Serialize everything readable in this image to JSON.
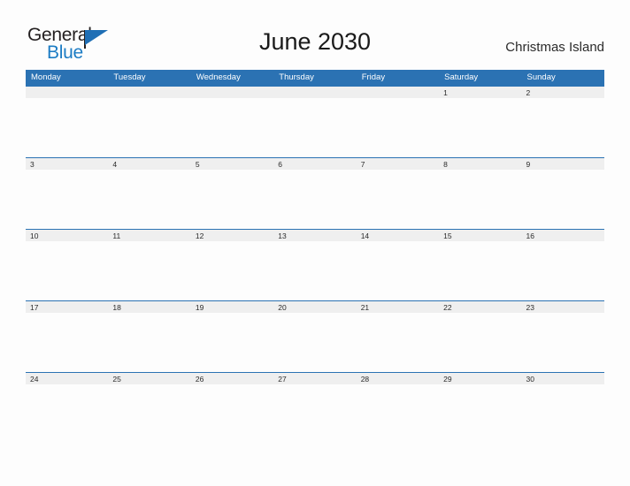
{
  "brand": {
    "name_part1": "General",
    "name_part2": "Blue",
    "flag_icon": "blue-flag-triangle",
    "color_dark": "#231f20",
    "color_blue": "#1c7cc4"
  },
  "header": {
    "month_title": "June 2030",
    "location": "Christmas Island"
  },
  "calendar": {
    "accent_color": "#2b72b3",
    "band_color": "#efefef",
    "weekdays": [
      "Monday",
      "Tuesday",
      "Wednesday",
      "Thursday",
      "Friday",
      "Saturday",
      "Sunday"
    ],
    "weeks": [
      [
        "",
        "",
        "",
        "",
        "",
        "1",
        "2"
      ],
      [
        "3",
        "4",
        "5",
        "6",
        "7",
        "8",
        "9"
      ],
      [
        "10",
        "11",
        "12",
        "13",
        "14",
        "15",
        "16"
      ],
      [
        "17",
        "18",
        "19",
        "20",
        "21",
        "22",
        "23"
      ],
      [
        "24",
        "25",
        "26",
        "27",
        "28",
        "29",
        "30"
      ]
    ]
  }
}
